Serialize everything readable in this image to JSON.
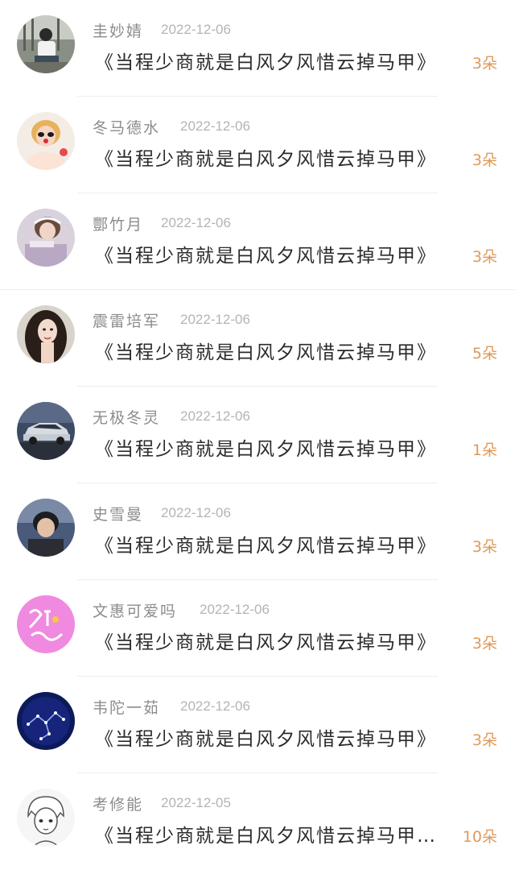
{
  "items": [
    {
      "name": "圭妙婧",
      "date": "2022-12-06",
      "title": "《当程少商就是白风夕风惜云掉马甲》",
      "count": "3朵",
      "avatar": "person-photo-icon"
    },
    {
      "name": "冬马德水",
      "date": "2022-12-06",
      "title": "《当程少商就是白风夕风惜云掉马甲》",
      "count": "3朵",
      "avatar": "person-photo-icon"
    },
    {
      "name": "酆竹月",
      "date": "2022-12-06",
      "title": "《当程少商就是白风夕风惜云掉马甲》",
      "count": "3朵",
      "avatar": "person-photo-icon"
    },
    {
      "name": "震雷培军",
      "date": "2022-12-06",
      "title": "《当程少商就是白风夕风惜云掉马甲》",
      "count": "5朵",
      "avatar": "person-photo-icon"
    },
    {
      "name": "无极冬灵",
      "date": "2022-12-06",
      "title": "《当程少商就是白风夕风惜云掉马甲》",
      "count": "1朵",
      "avatar": "car-photo-icon"
    },
    {
      "name": "史雪曼",
      "date": "2022-12-06",
      "title": "《当程少商就是白风夕风惜云掉马甲》",
      "count": "3朵",
      "avatar": "person-photo-icon"
    },
    {
      "name": "文惠可爱吗",
      "date": "2022-12-06",
      "title": "《当程少商就是白风夕风惜云掉马甲》",
      "count": "3朵",
      "avatar": "pink-text-avatar-icon"
    },
    {
      "name": "韦陀一茹",
      "date": "2022-12-06",
      "title": "《当程少商就是白风夕风惜云掉马甲》",
      "count": "3朵",
      "avatar": "constellation-avatar-icon"
    },
    {
      "name": "考修能",
      "date": "2022-12-05",
      "title": "《当程少商就是白风夕风惜云掉马甲…",
      "count": "10朵",
      "avatar": "sketch-portrait-icon"
    }
  ],
  "colors": {
    "name": "#8c8c8c",
    "date": "#b4b4b4",
    "title": "#2b2b2b",
    "count": "#e09a5a",
    "divider": "#eeeeee"
  }
}
